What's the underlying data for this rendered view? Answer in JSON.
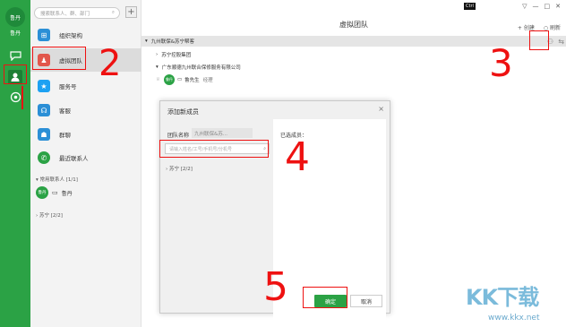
{
  "rail": {
    "avatar": "鲁丹",
    "name": "鲁丹"
  },
  "contacts": {
    "search_placeholder": "搜索联系人、群、部门",
    "plus": "+",
    "items": [
      {
        "label": "组织架构",
        "color": "#2b8fd6"
      },
      {
        "label": "虚拟团队",
        "color": "#e2574c"
      },
      {
        "label": "服务号",
        "color": "#1da1f2"
      },
      {
        "label": "客服",
        "color": "#2b8fd6"
      },
      {
        "label": "群聊",
        "color": "#2b8fd6"
      },
      {
        "label": "最近联系人",
        "color": "#2ba245"
      }
    ],
    "frequent": "常用联系人 [1/1]",
    "frequent_user": "鲁丹",
    "suning": "苏宁 [2/2]"
  },
  "topbar": {
    "badge": "Ctrl",
    "buttons": [
      "▽",
      "—",
      "□",
      "✕"
    ]
  },
  "main": {
    "title": "虚拟团队",
    "create_label": "创建",
    "refresh_label": "刷新",
    "rows": [
      {
        "text": "九州联保&苏宁帮客"
      },
      {
        "text": "苏宁控股集团"
      },
      {
        "text": "广东顺德九州联合保修服务有限公司"
      },
      {
        "avatar": "鲁丹",
        "text": "鲁先生",
        "role": "经理"
      }
    ]
  },
  "dialog": {
    "title": "添加新成员",
    "close": "×",
    "team_label": "团队名称",
    "team_value": "九州联保&苏...",
    "member_placeholder": "请输入姓名/工号/手机号/分机号",
    "group": "苏宁 [2/2]",
    "selected_label": "已选成员：",
    "ok": "确定",
    "cancel": "取消"
  },
  "annotations": [
    "2",
    "3",
    "4",
    "5"
  ],
  "watermark": {
    "logo": "KK下载",
    "url": "www.kkx.net"
  }
}
